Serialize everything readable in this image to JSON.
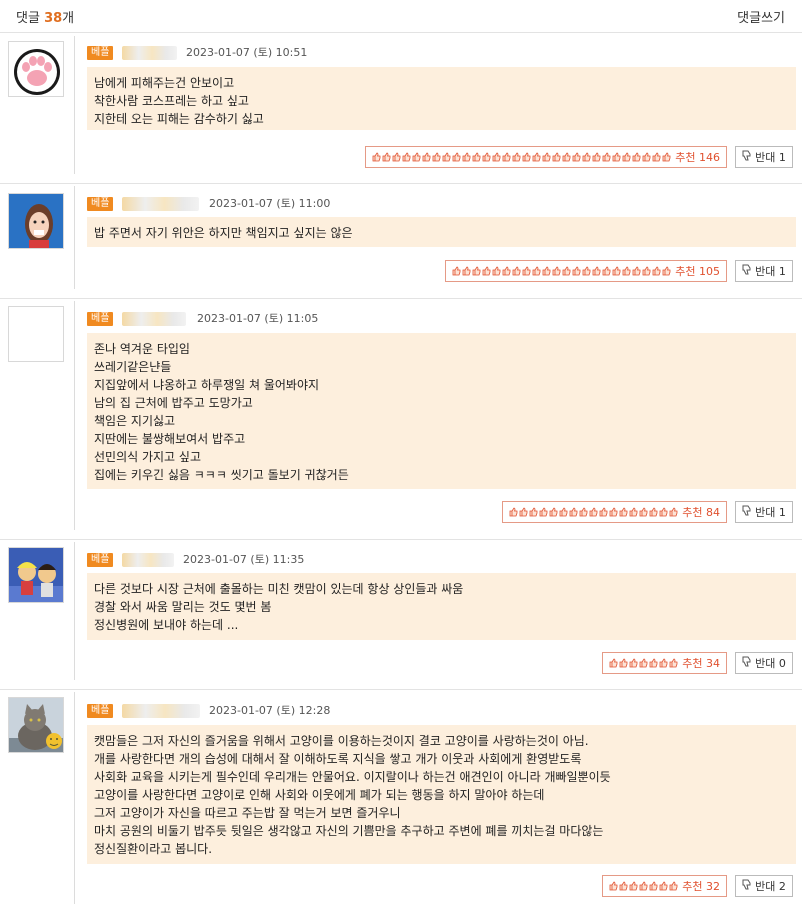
{
  "header": {
    "title_prefix": "댓글 ",
    "count": "38",
    "title_suffix": "개",
    "write_label": "댓글쓰기"
  },
  "colors": {
    "accent": "#e06e1f",
    "badge": "#f08a20",
    "comment_bg": "#fdefdd",
    "recommend": "#e0502e"
  },
  "comments": [
    {
      "badge": "베플",
      "date": "2023-01-07 (토) 10:51",
      "avatar": "paw-avatar",
      "lines": [
        "남에게 피해주는건 안보이고",
        "착한사람 코스프레는 하고 싶고",
        "지한테 오는 피해는 감수하기 싫고"
      ],
      "recommend_label": "추천 146",
      "oppose_label": "반대 1"
    },
    {
      "badge": "베플",
      "date": "2023-01-07 (토) 11:00",
      "avatar": "girl-avatar",
      "lines": [
        "밥 주면서 자기 위안은 하지만 책임지고 싶지는 않은"
      ],
      "recommend_label": "추천 105",
      "oppose_label": "반대 1"
    },
    {
      "badge": "베플",
      "date": "2023-01-07 (토) 11:05",
      "avatar": "empty-avatar",
      "lines": [
        "존나 역겨운 타입임",
        "쓰레기같은냔들",
        "지집앞에서 냐옹하고 하루쟁일 쳐 울어봐야지",
        "남의 집 근처에 밥주고 도망가고",
        "책임은 지기싫고",
        "지딴에는 불쌍해보여서 밥주고",
        "선민의식 가지고 싶고",
        "집에는 키우긴 싫음 ㅋㅋㅋ 씻기고 돌보기 귀찮거든"
      ],
      "recommend_label": "추천 84",
      "oppose_label": "반대 1"
    },
    {
      "badge": "베플",
      "date": "2023-01-07 (토) 11:35",
      "avatar": "cartoon-avatar",
      "lines": [
        "다른 것보다 시장 근처에 출몰하는 미친 캣맘이 있는데 항상 상인들과 싸움",
        "경찰 와서 싸움 말리는 것도 몇번 봄",
        "정신병원에 보내야 하는데 ..."
      ],
      "recommend_label": "추천 34",
      "oppose_label": "반대 0"
    },
    {
      "badge": "베플",
      "date": "2023-01-07 (토) 12:28",
      "avatar": "cat-avatar",
      "lines": [
        "캣맘들은 그저 자신의 즐거움을 위해서 고양이를 이용하는것이지 결코 고양이를 사랑하는것이 아님.",
        "개를 사랑한다면 개의 습성에 대해서 잘 이해하도록 지식을 쌓고 개가 이웃과 사회에게 환영받도록",
        "사회화 교육을 시키는게 필수인데 우리개는 안물어요. 이지랄이나 하는건 애견인이 아니라 개빠일뿐이듯",
        "고양이를 사랑한다면 고양이로 인해 사회와 이웃에게 폐가 되는 행동을 하지 말아야 하는데",
        "그저 고양이가 자신을 따르고 주는밥 잘 먹는거 보면 즐거우니",
        "마치 공원의 비둘기 밥주듯 뒷일은 생각않고 자신의 기쁨만을 추구하고 주변에 폐를 끼치는걸 마다않는",
        "정신질환이라고 봅니다."
      ],
      "recommend_label": "추천 32",
      "oppose_label": "반대 2"
    }
  ]
}
